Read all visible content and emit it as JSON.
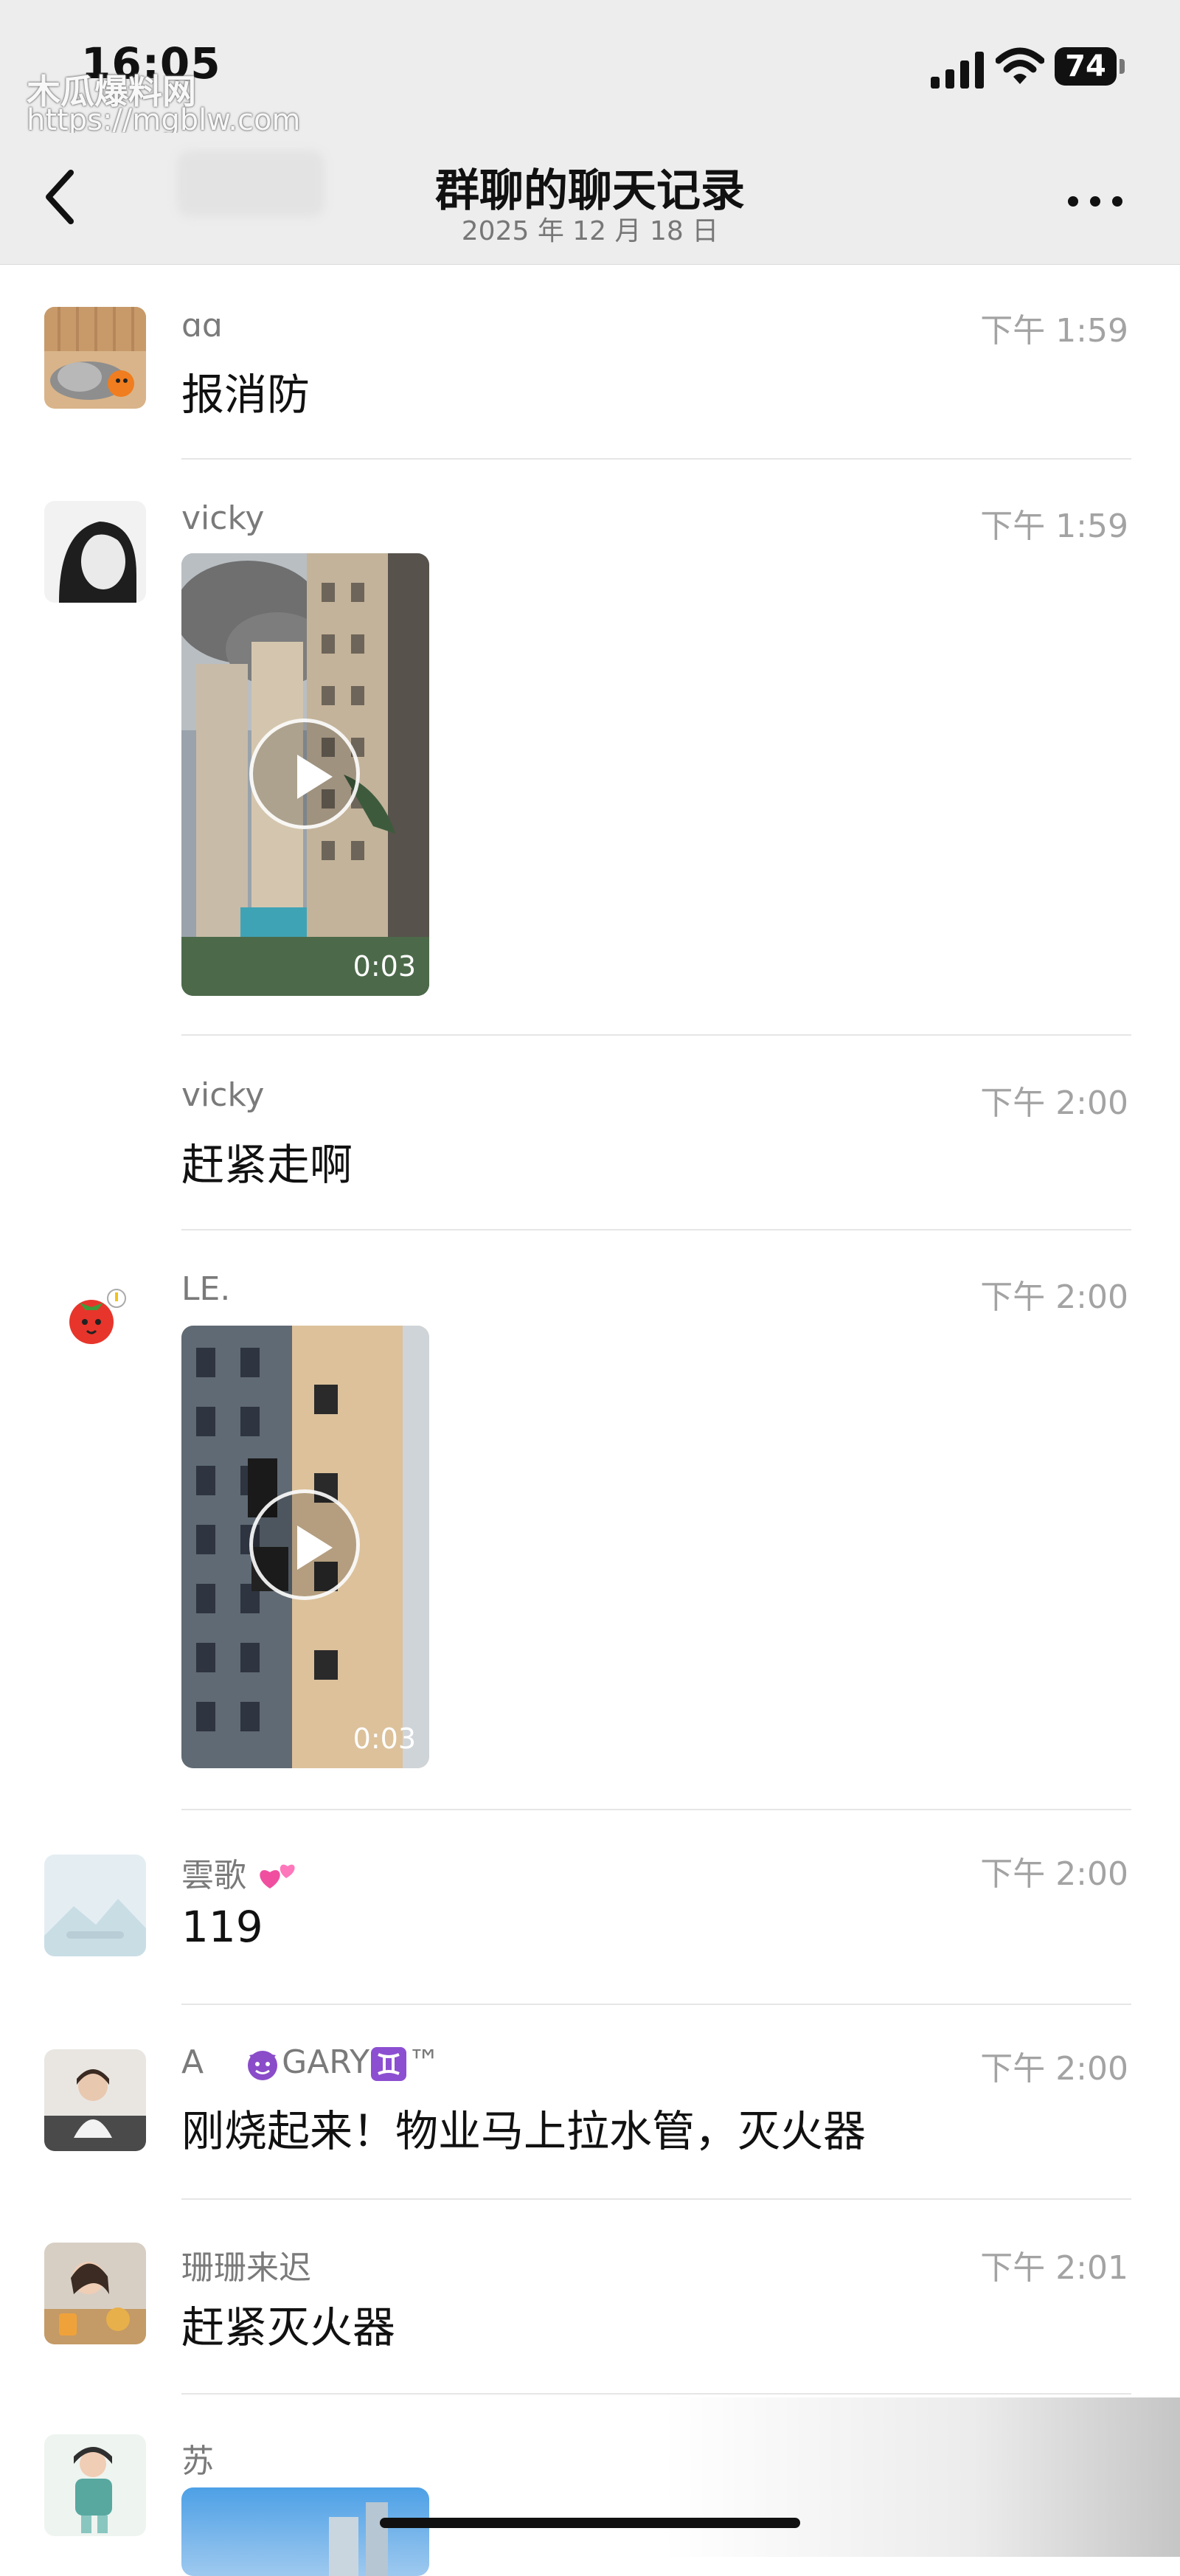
{
  "status_bar": {
    "time": "16:05",
    "battery": "74"
  },
  "watermark": {
    "line1": "木瓜爆料网",
    "line2": "https://mgblw.com"
  },
  "nav": {
    "title": "群聊的聊天记录",
    "date": "2025 年 12 月 18 日"
  },
  "messages": [
    {
      "name": "ɑɑ",
      "time": "下午 1:59",
      "text": "报消防"
    },
    {
      "name": "vicky",
      "time": "下午 1:59",
      "video_duration": "0:03"
    },
    {
      "name": "vicky",
      "time": "下午 2:00",
      "text": "赶紧走啊"
    },
    {
      "name": "LE.",
      "time": "下午 2:00",
      "video_duration": "0:03"
    },
    {
      "name": "雲歌",
      "time": "下午 2:00",
      "text": "119"
    },
    {
      "name_prefix": "A",
      "name_suffix": "GARY",
      "name_tm": "™",
      "time": "下午 2:00",
      "text": "刚烧起来！物业马上拉水管，灭火器"
    },
    {
      "name": "珊珊来迟",
      "time": "下午 2:01",
      "text": "赶紧灭火器"
    },
    {
      "name": "苏"
    }
  ],
  "colors": {
    "background": "#ffffff",
    "header": "#ededed",
    "name_gray": "#7a7a7a",
    "time_gray": "#a3a3a3"
  },
  "icons": [
    "signal-icon",
    "wifi-icon",
    "battery-icon",
    "back-chevron-icon",
    "more-icon",
    "play-icon"
  ]
}
